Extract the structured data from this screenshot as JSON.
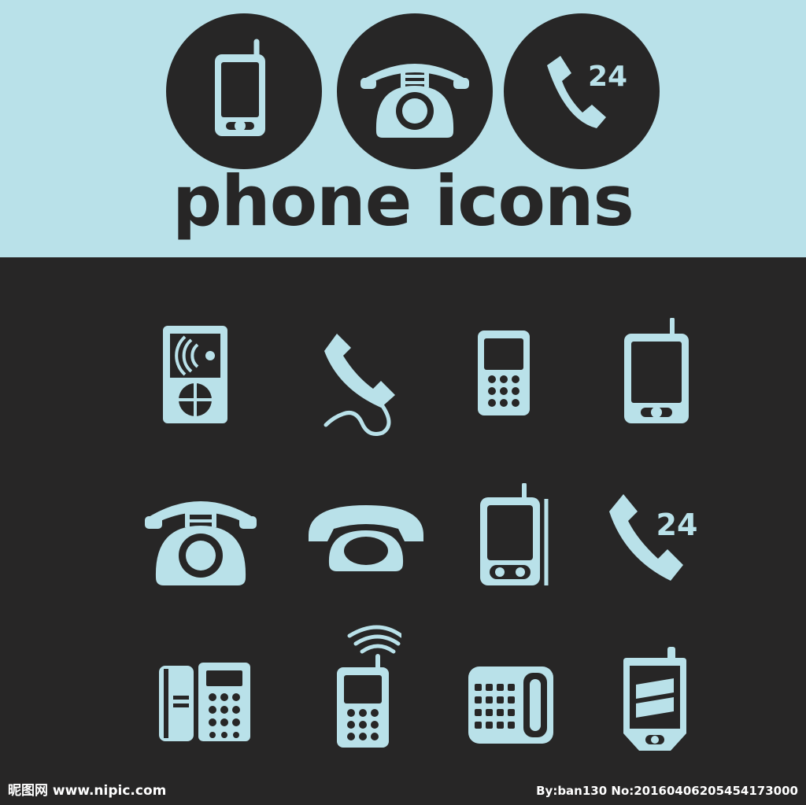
{
  "header": {
    "title": "phone icons",
    "badge_24_text": "24"
  },
  "icons": [
    "music-player-phone-icon",
    "corded-handset-icon",
    "keypad-mobile-icon",
    "touchscreen-mobile-icon",
    "retro-rotary-phone-icon",
    "classic-desk-phone-icon",
    "antenna-smartphone-icon",
    "phone-24-hours-icon",
    "office-desk-phone-icon",
    "signal-mobile-icon",
    "keypad-landline-icon",
    "pda-phone-icon"
  ],
  "icon_24_text": "24",
  "watermark": {
    "left": "昵图网 www.nipic.com",
    "right": "By:ban130 No:20160406205454173000"
  },
  "colors": {
    "accent": "#b9e1e9",
    "dark": "#272626"
  }
}
